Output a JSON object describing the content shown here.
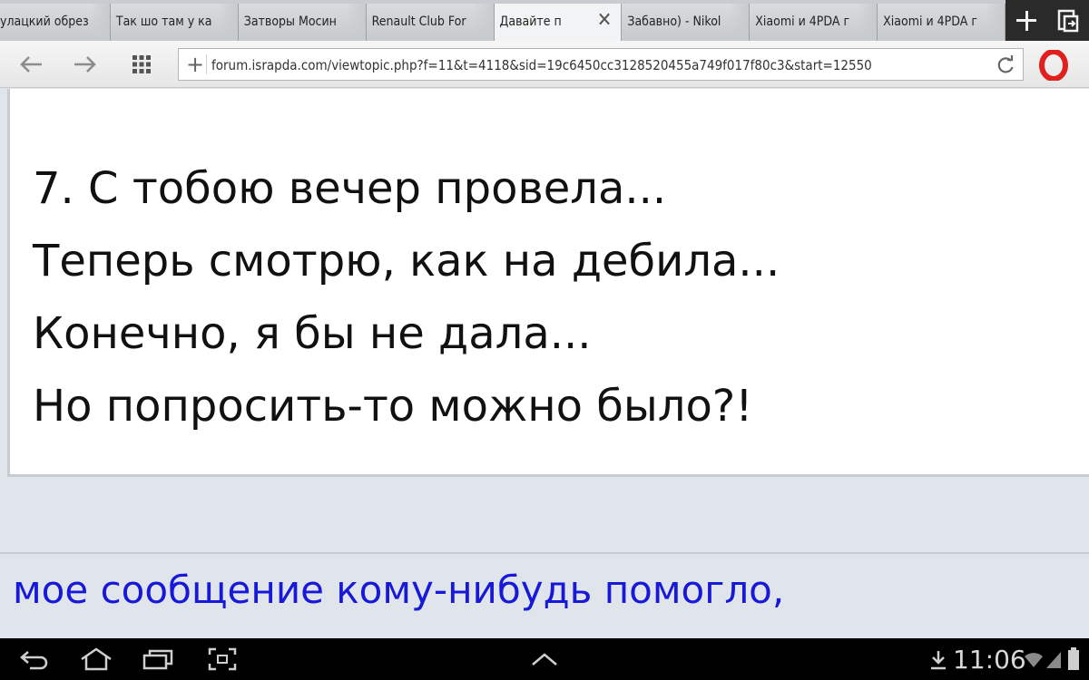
{
  "tabs": [
    {
      "label": "улацкий обрез",
      "active": false
    },
    {
      "label": "Так шо там у ка",
      "active": false
    },
    {
      "label": "Затворы Мосин",
      "active": false
    },
    {
      "label": "Renault Club For",
      "active": false
    },
    {
      "label": "Давайте п",
      "active": true,
      "close_glyph": "✕"
    },
    {
      "label": "Забавно) - Nikol",
      "active": false
    },
    {
      "label": "Xiaomi и 4PDA г",
      "active": false
    },
    {
      "label": "Xiaomi и 4PDA г",
      "active": false
    }
  ],
  "address_bar": {
    "url": "forum.israpda.com/viewtopic.php?f=11&t=4118&sid=19c6450cc3128520455a749f017f80c3&start=12550"
  },
  "post_image": {
    "lines": [
      "7. С тобою вечер провела...",
      "Теперь смотрю, как на дебила...",
      "Конечно, я бы не дала...",
      "Но попросить-то можно было?!"
    ]
  },
  "signature": {
    "text": "мое сообщение кому-нибудь помогло,",
    "color": "#1818d8"
  },
  "system_bar": {
    "time": "11:06",
    "icons": [
      "back-icon",
      "home-icon",
      "recent-apps-icon",
      "screenshot-icon",
      "menu-up-icon",
      "download-icon",
      "wifi-icon",
      "signal-icon",
      "battery-icon"
    ]
  },
  "colors": {
    "accent_opera": "#e0201c",
    "page_background": "#dfe5ea"
  }
}
